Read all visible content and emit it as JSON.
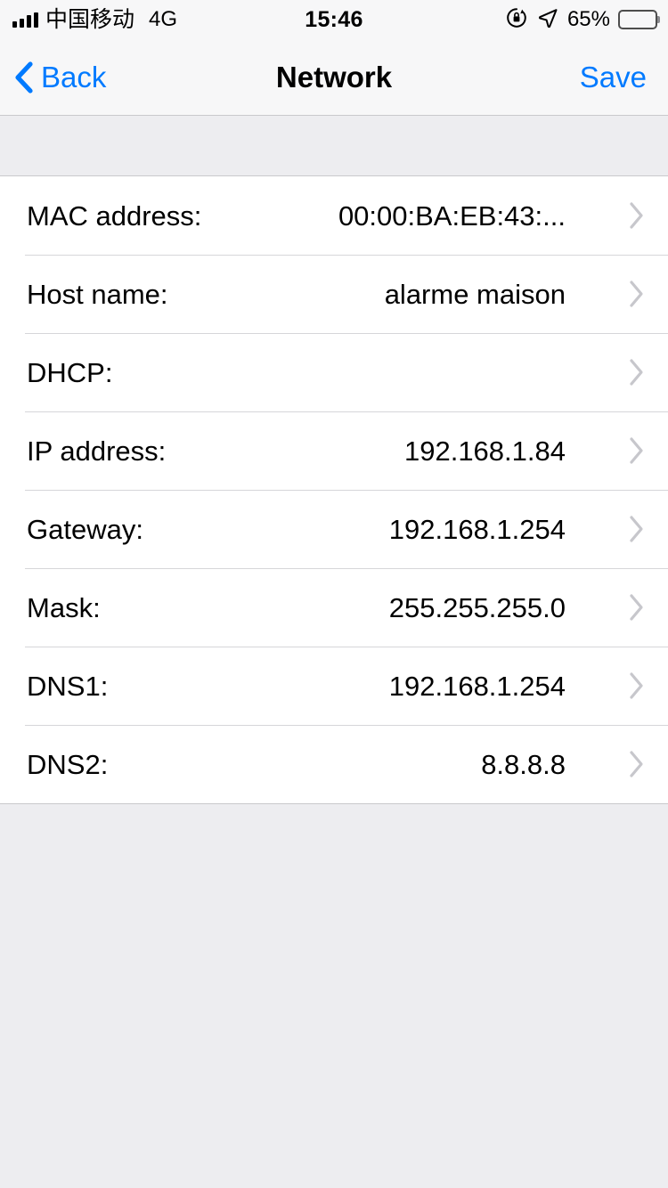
{
  "status_bar": {
    "carrier": "中国移动",
    "network_mode": "4G",
    "time": "15:46",
    "battery_percent": "65%",
    "battery_level": 65,
    "signal_bars": 4,
    "icons": [
      "signal-bars-icon",
      "rotation-lock-icon",
      "location-arrow-icon",
      "battery-icon"
    ]
  },
  "nav_bar": {
    "back_label": "Back",
    "title": "Network",
    "save_label": "Save",
    "accent_color": "#007aff"
  },
  "list": {
    "rows": [
      {
        "label": "MAC address:",
        "value": "00:00:BA:EB:43:..."
      },
      {
        "label": "Host name:",
        "value": "alarme maison"
      },
      {
        "label": "DHCP:",
        "value": ""
      },
      {
        "label": "IP address:",
        "value": "192.168.1.84"
      },
      {
        "label": "Gateway:",
        "value": "192.168.1.254"
      },
      {
        "label": "Mask:",
        "value": "255.255.255.0"
      },
      {
        "label": "DNS1:",
        "value": "192.168.1.254"
      },
      {
        "label": "DNS2:",
        "value": "8.8.8.8"
      }
    ]
  },
  "colors": {
    "page_background": "#ededf0",
    "bar_background": "#f7f7f8",
    "row_background": "#ffffff",
    "separator": "#d6d6d9",
    "chevron": "#c7c7cc",
    "text": "#000000"
  }
}
